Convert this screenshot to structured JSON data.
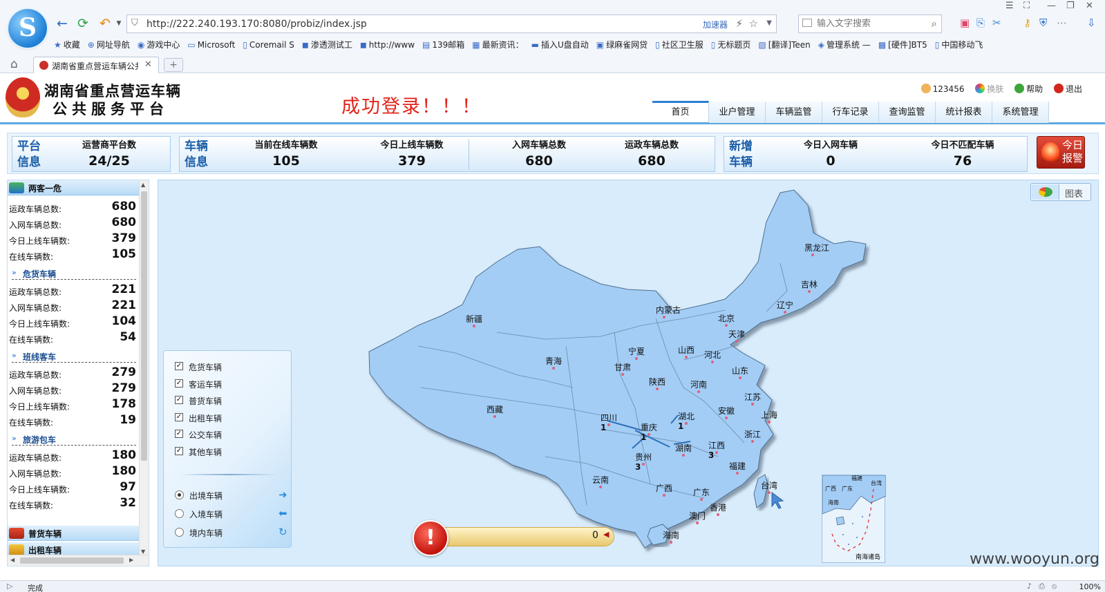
{
  "browser": {
    "url": "http://222.240.193.170:8080/probiz/index.jsp",
    "accelerator": "加速器",
    "search_placeholder": "输入文字搜索",
    "tab_title": "湖南省重点营运车辆公共",
    "status": "完成",
    "zoom": "100%",
    "bookmarks": [
      "收藏",
      "网址导航",
      "游戏中心",
      "Microsoft",
      "Coremail S",
      "渗透测试工",
      "http://www",
      "139邮箱",
      "最新资讯：",
      "插入U盘自动",
      "绿麻雀网贷",
      "社区卫生服",
      "无标题页",
      "[翻译]Teen",
      "管理系统 —",
      "[硬件]BT5",
      "中国移动飞"
    ]
  },
  "header": {
    "title_line1": "湖南省重点营运车辆",
    "title_line2": "公共服务平台",
    "login_message": "成功登录！！！",
    "user": "123456",
    "skin": "换肤",
    "help": "帮助",
    "logout": "退出",
    "nav": [
      "首页",
      "业户管理",
      "车辆监管",
      "行车记录",
      "查询监管",
      "统计报表",
      "系统管理"
    ]
  },
  "stats": {
    "platform": {
      "label1": "平台",
      "label2": "信息",
      "items": [
        {
          "name": "运营商平台数",
          "value": "24/25"
        }
      ]
    },
    "vehicle": {
      "label1": "车辆",
      "label2": "信息",
      "items": [
        {
          "name": "当前在线车辆数",
          "value": "105"
        },
        {
          "name": "今日上线车辆数",
          "value": "379"
        },
        {
          "name": "入网车辆总数",
          "value": "680"
        },
        {
          "name": "运政车辆总数",
          "value": "680"
        }
      ]
    },
    "new": {
      "label1": "新增",
      "label2": "车辆",
      "items": [
        {
          "name": "今日入网车辆",
          "value": "0"
        },
        {
          "name": "今日不匹配车辆",
          "value": "76"
        }
      ]
    },
    "alarm_label": "今日报警"
  },
  "sidebar": {
    "main_header": "两客一危",
    "overview": [
      {
        "label": "运政车辆总数:",
        "value": "680"
      },
      {
        "label": "入网车辆总数:",
        "value": "680"
      },
      {
        "label": "今日上线车辆数:",
        "value": "379"
      },
      {
        "label": "在线车辆数:",
        "value": "105"
      }
    ],
    "sections": [
      {
        "title": "危货车辆",
        "rows": [
          {
            "label": "运政车辆总数:",
            "value": "221"
          },
          {
            "label": "入网车辆总数:",
            "value": "221"
          },
          {
            "label": "今日上线车辆数:",
            "value": "104"
          },
          {
            "label": "在线车辆数:",
            "value": "54"
          }
        ]
      },
      {
        "title": "班线客车",
        "rows": [
          {
            "label": "运政车辆总数:",
            "value": "279"
          },
          {
            "label": "入网车辆总数:",
            "value": "279"
          },
          {
            "label": "今日上线车辆数:",
            "value": "178"
          },
          {
            "label": "在线车辆数:",
            "value": "19"
          }
        ]
      },
      {
        "title": "旅游包车",
        "rows": [
          {
            "label": "运政车辆总数:",
            "value": "180"
          },
          {
            "label": "入网车辆总数:",
            "value": "180"
          },
          {
            "label": "今日上线车辆数:",
            "value": "97"
          },
          {
            "label": "在线车辆数:",
            "value": "32"
          }
        ]
      }
    ],
    "bottom_headers": [
      "普货车辆",
      "出租车辆"
    ]
  },
  "map": {
    "chart_toggle": "图表",
    "filters": [
      "危货车辆",
      "客运车辆",
      "普货车辆",
      "出租车辆",
      "公交车辆",
      "其他车辆"
    ],
    "directions": [
      "出境车辆",
      "入境车辆",
      "境内车辆"
    ],
    "selected_direction": "出境车辆",
    "alert_count": "0",
    "provinces": [
      {
        "name": "黑龙江"
      },
      {
        "name": "吉林"
      },
      {
        "name": "辽宁"
      },
      {
        "name": "内蒙古"
      },
      {
        "name": "北京"
      },
      {
        "name": "天津"
      },
      {
        "name": "新疆"
      },
      {
        "name": "宁夏"
      },
      {
        "name": "山西"
      },
      {
        "name": "河北"
      },
      {
        "name": "山东"
      },
      {
        "name": "青海"
      },
      {
        "name": "甘肃"
      },
      {
        "name": "陕西"
      },
      {
        "name": "河南"
      },
      {
        "name": "江苏"
      },
      {
        "name": "西藏"
      },
      {
        "name": "安徽"
      },
      {
        "name": "上海"
      },
      {
        "name": "四川"
      },
      {
        "name": "重庆"
      },
      {
        "name": "湖北"
      },
      {
        "name": "浙江"
      },
      {
        "name": "湖南"
      },
      {
        "name": "江西"
      },
      {
        "name": "贵州"
      },
      {
        "name": "福建"
      },
      {
        "name": "台湾"
      },
      {
        "name": "云南"
      },
      {
        "name": "广西"
      },
      {
        "name": "广东"
      },
      {
        "name": "香港"
      },
      {
        "name": "澳门"
      },
      {
        "name": "海南"
      }
    ],
    "counts": [
      {
        "province": "四川",
        "value": "1"
      },
      {
        "province": "重庆",
        "value": "1"
      },
      {
        "province": "湖北",
        "value": "1"
      },
      {
        "province": "贵州",
        "value": "3"
      },
      {
        "province": "江西",
        "value": "3"
      }
    ],
    "inset_label": "南海诸岛",
    "inset_places": [
      "福建",
      "广西",
      "广东",
      "台湾",
      "海南"
    ]
  },
  "watermark": "www.wooyun.org"
}
